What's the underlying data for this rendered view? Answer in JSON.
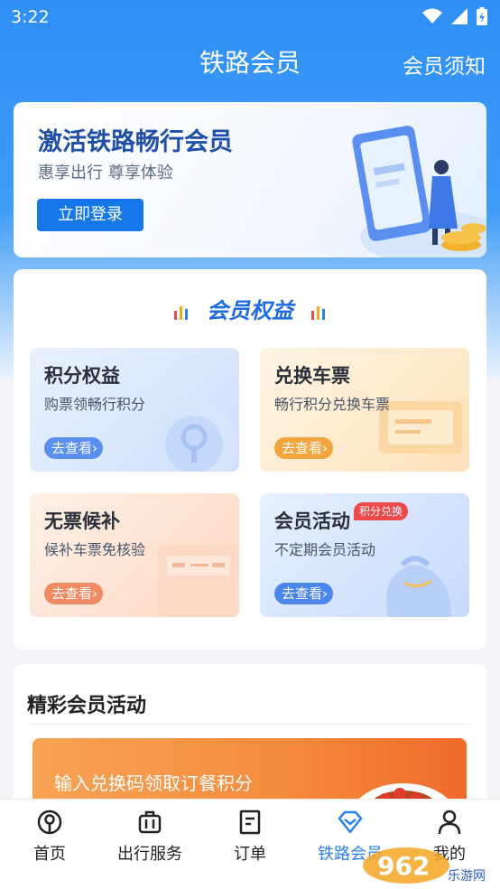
{
  "status_bar": {
    "time": "3:22"
  },
  "nav": {
    "title": "铁路会员",
    "right_link": "会员须知"
  },
  "banner": {
    "title": "激活铁路畅行会员",
    "subtitle": "惠享出行 尊享体验",
    "login_button": "立即登录"
  },
  "benefits": {
    "title": "会员权益",
    "tiles": [
      {
        "title": "积分权益",
        "subtitle": "购票领畅行积分",
        "button": "去查看"
      },
      {
        "title": "兑换车票",
        "subtitle": "畅行积分兑换车票",
        "button": "去查看"
      },
      {
        "title": "无票候补",
        "subtitle": "候补车票免核验",
        "button": "去查看"
      },
      {
        "title": "会员活动",
        "subtitle": "不定期会员活动",
        "button": "去查看",
        "tag": "积分兑换"
      }
    ]
  },
  "activities": {
    "title": "精彩会员活动",
    "banner_text": "输入兑换码领取订餐积分"
  },
  "tab_bar": {
    "items": [
      {
        "label": "首页",
        "icon": "railway-logo-icon"
      },
      {
        "label": "出行服务",
        "icon": "luggage-icon"
      },
      {
        "label": "订单",
        "icon": "order-document-icon"
      },
      {
        "label": "铁路会员",
        "icon": "diamond-icon",
        "active": true
      },
      {
        "label": "我的",
        "icon": "user-icon"
      }
    ]
  },
  "watermark": {
    "text": "962",
    "site": "乐游网"
  },
  "colors": {
    "primary_blue": "#2f8ff5",
    "login_blue": "#1677e8",
    "active_tab": "#2a80f0",
    "tag_red": "#f0474a"
  }
}
